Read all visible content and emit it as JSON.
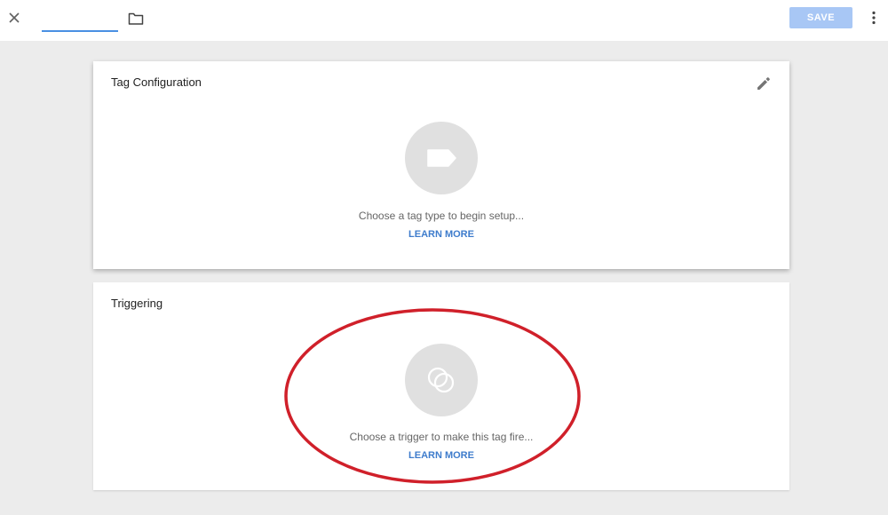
{
  "toolbar": {
    "name_value": "",
    "save_label": "SAVE",
    "icons": {
      "close": "close-icon",
      "folder": "folder-icon",
      "more": "more-vert-icon"
    },
    "colors": {
      "input_underline": "#4a90e2",
      "save_disabled": "#a8c7f5"
    }
  },
  "tag_config": {
    "title": "Tag Configuration",
    "description": "Choose a tag type to begin setup...",
    "learn_more": "LEARN MORE",
    "icons": {
      "edit": "pencil-icon",
      "tag": "tag-icon"
    }
  },
  "triggering": {
    "title": "Triggering",
    "description": "Choose a trigger to make this tag fire...",
    "learn_more": "LEARN MORE",
    "icons": {
      "trigger": "trigger-icon"
    }
  },
  "annotation": {
    "color": "#d0202a",
    "shape": "ellipse"
  },
  "colors": {
    "background": "#ececec",
    "link": "#3e7ccc",
    "placeholder_circle": "#e0e0e0"
  }
}
